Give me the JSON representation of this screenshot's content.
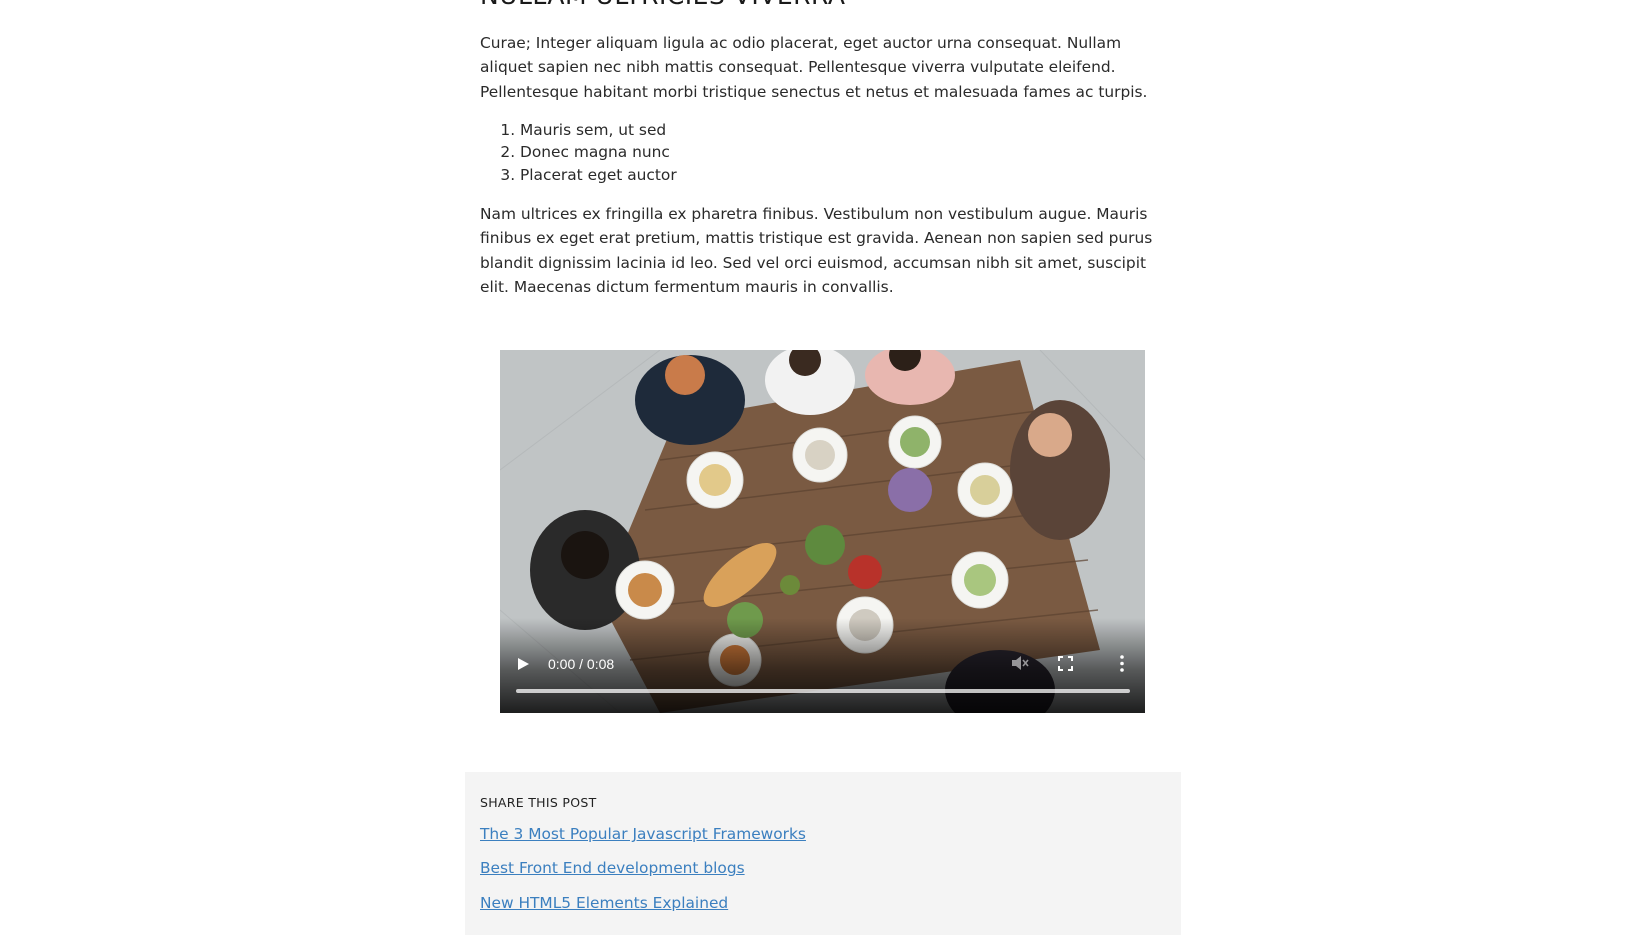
{
  "article": {
    "heading": "NULLAM ULTRICIES VIVERRA",
    "paragraph_1": "Curae; Integer aliquam ligula ac odio placerat, eget auctor urna consequat. Nullam aliquet sapien nec nibh mattis consequat. Pellentesque viverra vulputate eleifend. Pellentesque habitant morbi tristique senectus et netus et malesuada fames ac turpis.",
    "list_items": [
      "Mauris sem, ut sed",
      "Donec magna nunc",
      "Placerat eget auctor"
    ],
    "paragraph_2": "Nam ultrices ex fringilla ex pharetra finibus. Vestibulum non vestibulum augue. Mauris finibus ex eget erat pretium, mattis tristique est gravida. Aenean non sapien sed purus blandit dignissim lacinia id leo. Sed vel orci euismod, accumsan nibh sit amet, suscipit elit. Maecenas dictum fermentum mauris in convallis."
  },
  "video": {
    "time_display": "0:00 / 0:08",
    "progress": 0,
    "icons": {
      "play": "play-icon",
      "mute": "volume-muted-icon",
      "fullscreen": "fullscreen-icon",
      "more": "more-vertical-icon"
    }
  },
  "share": {
    "title": "SHARE THIS POST",
    "links": [
      "The 3 Most Popular Javascript Frameworks",
      "Best Front End development blogs",
      "New HTML5 Elements Explained"
    ]
  },
  "colors": {
    "link": "#3b7fbf",
    "share_background": "#f4f4f4",
    "text": "#2a2a2a"
  }
}
